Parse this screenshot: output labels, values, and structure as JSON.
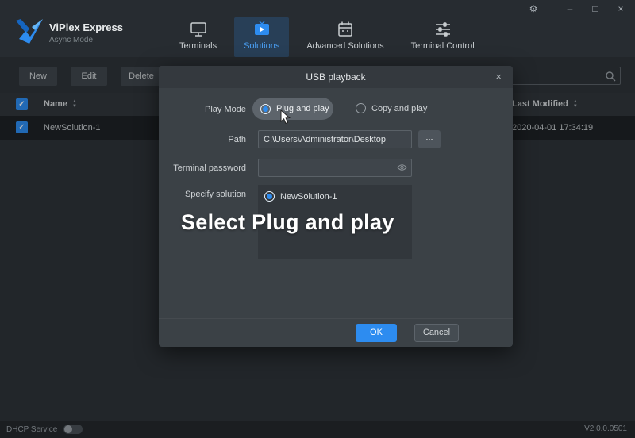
{
  "app": {
    "title": "ViPlex Express",
    "subtitle": "Async Mode",
    "version": "V2.0.0.0501"
  },
  "nav": {
    "tabs": [
      {
        "label": "Terminals",
        "active": false
      },
      {
        "label": "Solutions",
        "active": true
      },
      {
        "label": "Advanced Solutions",
        "active": false
      },
      {
        "label": "Terminal Control",
        "active": false
      }
    ]
  },
  "toolbar": {
    "new_label": "New",
    "edit_label": "Edit",
    "delete_label": "Delete",
    "search_value": ""
  },
  "table": {
    "columns": [
      "Name",
      "Last Modified"
    ],
    "rows": [
      {
        "checked": true,
        "name": "NewSolution-1",
        "last_modified": "2020-04-01 17:34:19"
      }
    ]
  },
  "dialog": {
    "title": "USB playback",
    "play_mode_label": "Play Mode",
    "plug_and_play_label": "Plug and play",
    "copy_and_play_label": "Copy and play",
    "path_label": "Path",
    "path_value": "C:\\Users\\Administrator\\Desktop",
    "browse_label": "...",
    "terminal_password_label": "Terminal password",
    "terminal_password_value": "",
    "specify_solution_label": "Specify solution",
    "solution_option": "NewSolution-1",
    "annotation": "Select Plug and play",
    "ok_label": "OK",
    "cancel_label": "Cancel"
  },
  "statusbar": {
    "dhcp_label": "DHCP Service"
  },
  "icons": {
    "gear": "⚙",
    "minimize": "–",
    "maximize": "□",
    "close": "×",
    "check": "✓",
    "sort_up": "▲",
    "sort_down": "▼",
    "modal_close": "×"
  },
  "colors": {
    "accent": "#2d8cf0",
    "modal_bg": "#3b4146",
    "topbar_bg": "#272c31"
  }
}
